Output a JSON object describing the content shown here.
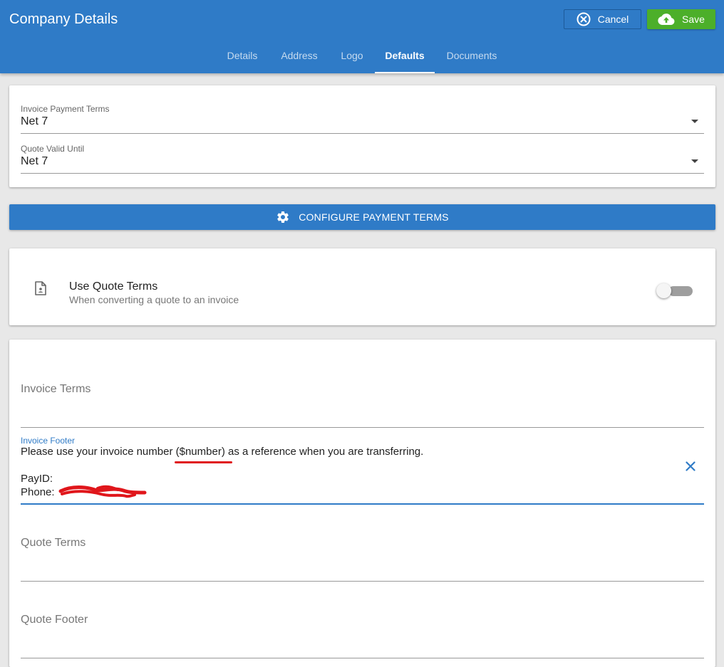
{
  "header": {
    "title": "Company Details",
    "cancel_label": "Cancel",
    "save_label": "Save",
    "tabs": [
      {
        "label": "Details"
      },
      {
        "label": "Address"
      },
      {
        "label": "Logo"
      },
      {
        "label": "Defaults",
        "active": true
      },
      {
        "label": "Documents"
      }
    ]
  },
  "defaults": {
    "invoice_payment_terms": {
      "label": "Invoice Payment Terms",
      "value": "Net 7"
    },
    "quote_valid_until": {
      "label": "Quote Valid Until",
      "value": "Net 7"
    }
  },
  "configure_button": {
    "label": "CONFIGURE PAYMENT TERMS",
    "icon": "gear-icon"
  },
  "quote_terms_toggle": {
    "title": "Use Quote Terms",
    "subtitle": "When converting a quote to an invoice",
    "icon": "document-icon",
    "enabled": false
  },
  "terms": {
    "invoice_terms": {
      "placeholder": "Invoice Terms"
    },
    "invoice_footer": {
      "label": "Invoice Footer",
      "line1_before": "Please use your invoice number ",
      "line1_highlight": "($number)",
      "line1_after": " as a reference when you are transferring.",
      "line2": "PayID:",
      "line3_prefix": "Phone: "
    },
    "quote_terms": {
      "placeholder": "Quote Terms"
    },
    "quote_footer": {
      "placeholder": "Quote Footer"
    }
  },
  "colors": {
    "header_blue": "#2f7bc7",
    "save_green": "#4caf2a",
    "focus_blue": "#2f7bc7",
    "annotation_red": "#e0161b"
  }
}
